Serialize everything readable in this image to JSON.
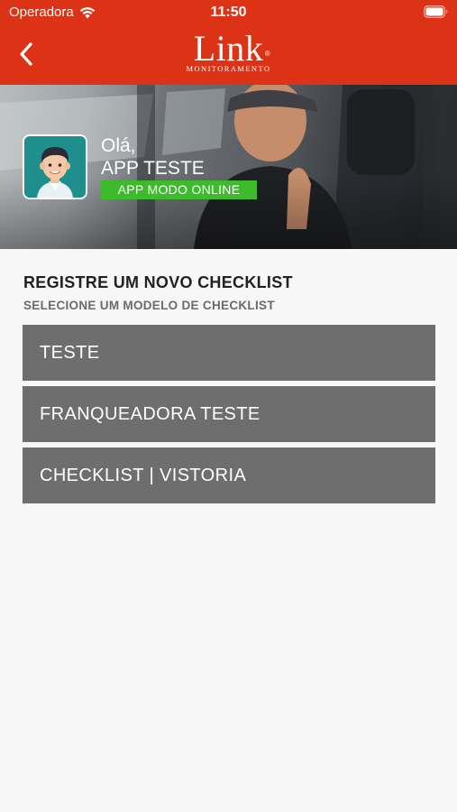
{
  "status_bar": {
    "carrier": "Operadora",
    "time": "11:50"
  },
  "nav": {
    "logo_text": "Link",
    "logo_mark": "®",
    "logo_subtitle": "MONITORAMENTO",
    "back_icon": "chevron-left-icon"
  },
  "profile": {
    "greeting": "Olá,",
    "name": "APP TESTE",
    "mode_badge": "APP MODO ONLINE"
  },
  "section": {
    "title": "REGISTRE UM NOVO CHECKLIST",
    "subtitle": "SELECIONE UM MODELO DE CHECKLIST"
  },
  "models": [
    {
      "label": "TESTE"
    },
    {
      "label": "FRANQUEADORA TESTE"
    },
    {
      "label": "CHECKLIST | VISTORIA"
    }
  ],
  "colors": {
    "brand_red": "#dc3215",
    "online_green": "#3dbb2c",
    "item_gray": "#6e6e6e",
    "avatar_teal": "#1f8f8e"
  }
}
